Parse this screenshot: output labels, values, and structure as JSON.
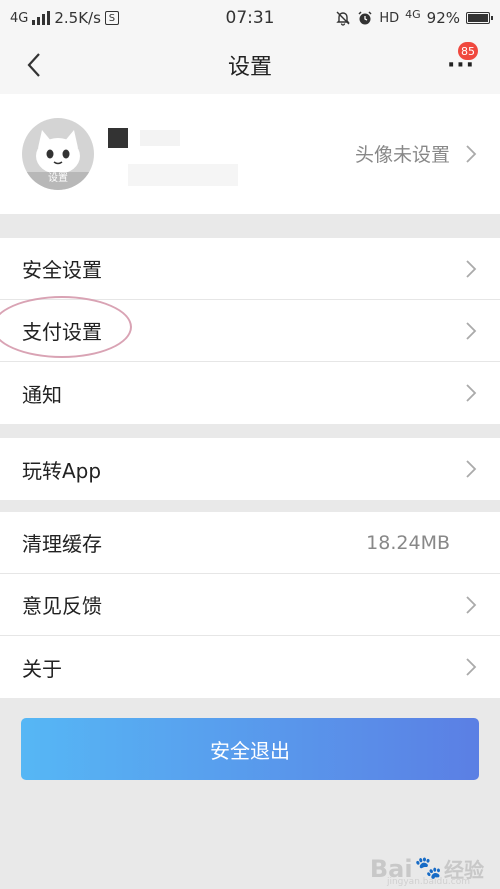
{
  "status_bar": {
    "network": "4G",
    "speed": "2.5K/s",
    "s_icon": "S",
    "time": "07:31",
    "hd": "HD",
    "network_right": "4G",
    "battery": "92%",
    "battery_level": 0.92,
    "icons": [
      "signal-icon",
      "mute-bell-icon",
      "alarm-icon",
      "battery-icon"
    ]
  },
  "nav": {
    "title": "设置",
    "more_label": "···",
    "badge_count": "85"
  },
  "profile": {
    "avatar_label": "设置",
    "hint": "头像未设置"
  },
  "groups": [
    {
      "items": [
        {
          "label": "安全设置",
          "has_arrow": true
        },
        {
          "label": "支付设置",
          "has_arrow": true
        },
        {
          "label": "通知",
          "has_arrow": true
        }
      ]
    },
    {
      "items": [
        {
          "label": "玩转App",
          "has_arrow": true
        }
      ]
    },
    {
      "items": [
        {
          "label": "清理缓存",
          "value": "18.24MB",
          "has_arrow": false
        },
        {
          "label": "意见反馈",
          "has_arrow": true
        },
        {
          "label": "关于",
          "has_arrow": true
        }
      ]
    }
  ],
  "logout_label": "安全退出",
  "watermark": {
    "text": "Bai",
    "text2": "经验",
    "sub": "jingyan.baidu.com"
  },
  "colors": {
    "accent_start": "#56b7f5",
    "accent_end": "#5b7fe4",
    "badge": "#f0483e",
    "annotation_circle": "#d9a3b4"
  }
}
